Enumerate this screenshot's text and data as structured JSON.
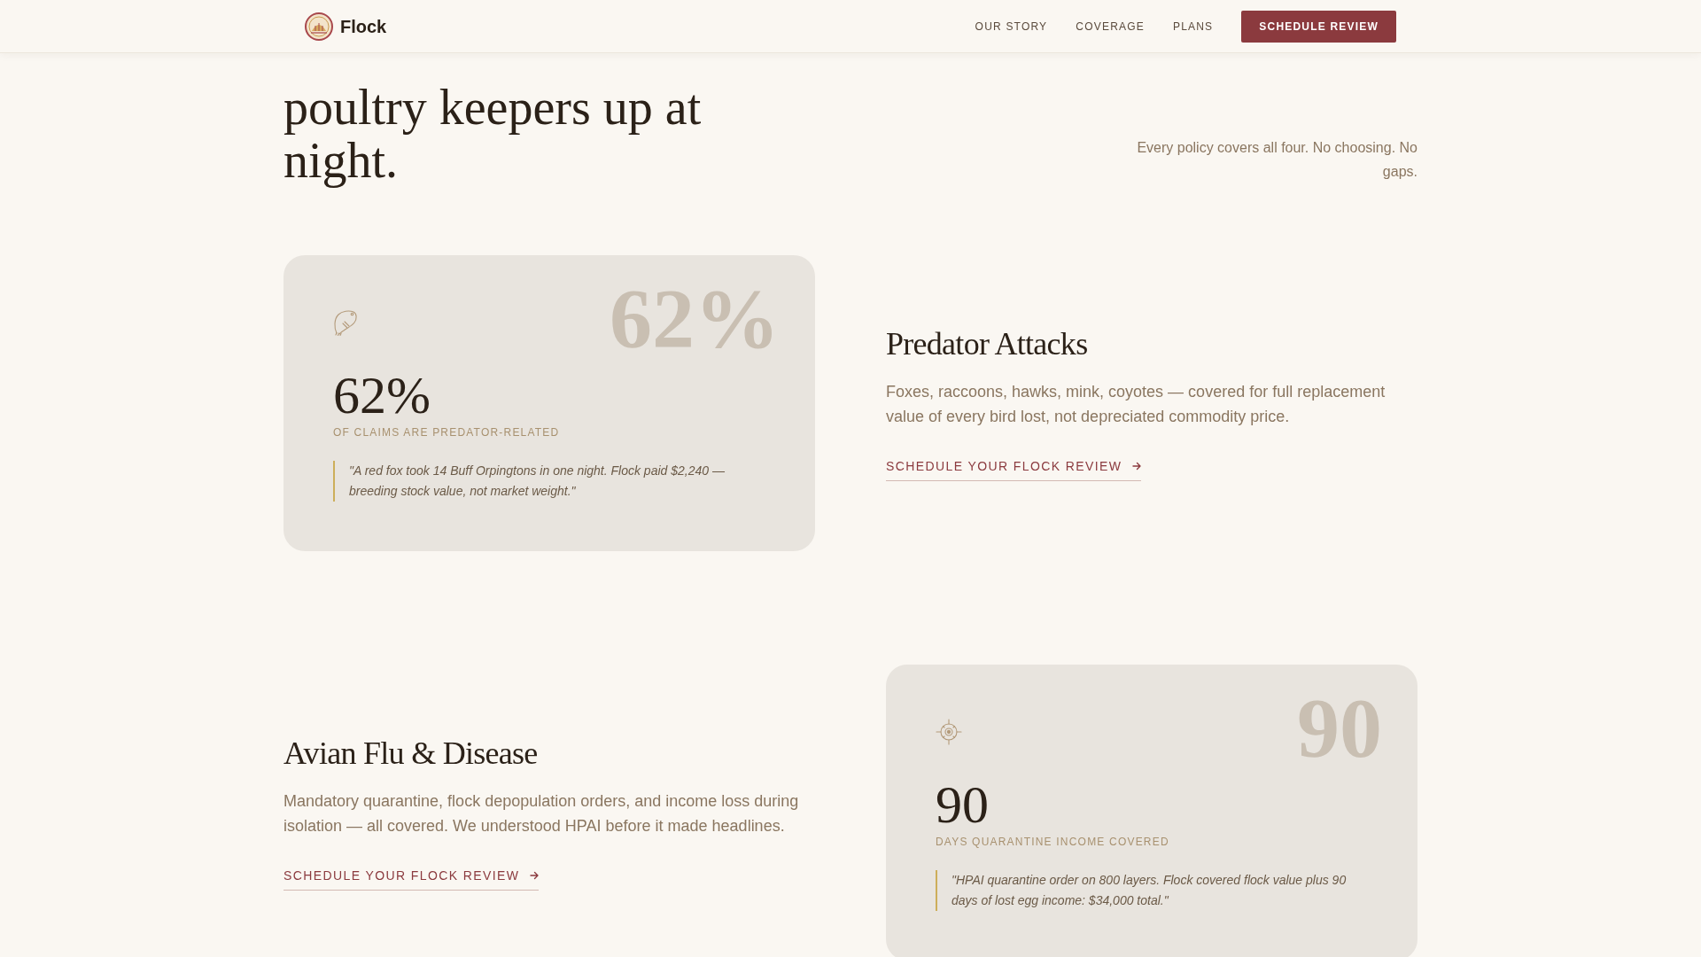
{
  "nav": {
    "brand": "Flock",
    "links": [
      "OUR STORY",
      "COVERAGE",
      "PLANS"
    ],
    "button": "SCHEDULE REVIEW"
  },
  "header": {
    "title": "poultry keepers up at night.",
    "note": "Every policy covers all four. No choosing. No gaps."
  },
  "risks": [
    {
      "title": "Predator Attacks",
      "description": "Foxes, raccoons, hawks, mink, coyotes — covered for full replacement value of every bird lost, not depreciated commodity price.",
      "link": "SCHEDULE YOUR FLOCK REVIEW",
      "stat": {
        "watermark": "62%",
        "value": "62%",
        "label": "OF CLAIMS ARE PREDATOR-RELATED",
        "quote": "\"A red fox took 14 Buff Orpingtons in one night. Flock paid $2,240 — breeding stock value, not market weight.\""
      }
    },
    {
      "title": "Avian Flu & Disease",
      "description": "Mandatory quarantine, flock depopulation orders, and income loss during isolation — all covered. We understood HPAI before it made headlines.",
      "link": "SCHEDULE YOUR FLOCK REVIEW",
      "stat": {
        "watermark": "90",
        "value": "90",
        "label": "DAYS QUARANTINE INCOME COVERED",
        "quote": "\"HPAI quarantine order on 800 layers. Flock covered flock value plus 90 days of lost egg income: $34,000 total.\""
      }
    }
  ]
}
